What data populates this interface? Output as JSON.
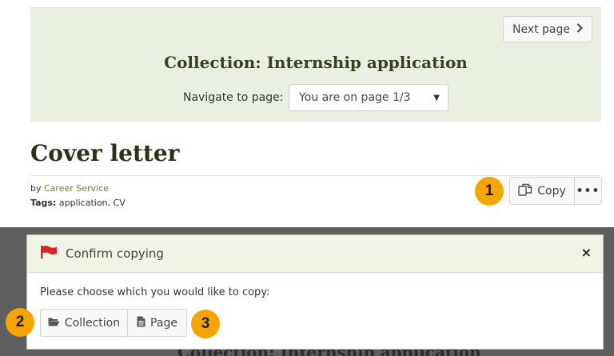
{
  "collection_nav": {
    "next_label": "Next page",
    "title": "Collection: Internship application",
    "navigate_label": "Navigate to page:",
    "select_value": "You are on page 1/3"
  },
  "page": {
    "title": "Cover letter",
    "by_prefix": "by",
    "author": "Career Service",
    "tags_label": "Tags:",
    "tags": "application, CV"
  },
  "actions": {
    "copy_label": "Copy",
    "more_label": "•••"
  },
  "callouts": [
    "1",
    "2",
    "3"
  ],
  "modal": {
    "title": "Confirm copying",
    "close_label": "×",
    "prompt": "Please choose which you would like to copy:",
    "collection_label": "Collection",
    "page_label": "Page"
  },
  "background_peek": "Collection: Internship application",
  "colors": {
    "panel_bg": "#eaf0e1",
    "link_green": "#5b8a2a",
    "callout": "#f6a500",
    "flag_red": "#d9262c",
    "overlay": "#5e5e5e"
  },
  "icons": {
    "next": "chevron-right-icon",
    "select": "caret-down-icon",
    "copy": "copy-icon",
    "more": "ellipsis-icon",
    "flag": "flag-icon",
    "close": "close-icon",
    "collection": "folder-open-icon",
    "page": "file-text-icon"
  }
}
